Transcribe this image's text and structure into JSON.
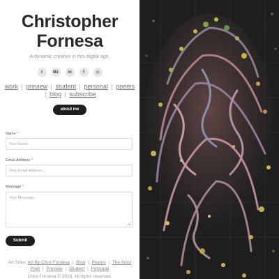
{
  "header": {
    "title_line1": "Christopher",
    "title_line2": "Fornesa",
    "tagline": "A dynamic creative in this digital age."
  },
  "socials": [
    {
      "icon": "twitter-icon",
      "glyph": "t"
    },
    {
      "icon": "behance-icon",
      "glyph": "Bē"
    },
    {
      "icon": "linkedin-icon",
      "glyph": "in"
    },
    {
      "icon": "facebook-icon",
      "glyph": "f"
    },
    {
      "icon": "instagram-icon",
      "glyph": "◎"
    }
  ],
  "nav": {
    "links": [
      "work",
      "preview",
      "student",
      "personal",
      "poems",
      "blog",
      "subscribe"
    ],
    "separator": "|"
  },
  "about_button": "about me",
  "form": {
    "name_label": "Name",
    "name_placeholder": "Your Name...",
    "email_label": "Email Address",
    "email_placeholder": "Your Email Address...",
    "message_label": "Message",
    "message_placeholder": "Your Message...",
    "required_mark": "*",
    "submit": "Submit"
  },
  "footer": {
    "art_sites_prefix": "Art Sites:",
    "art_sites": [
      "Art By Chris Fornesa",
      "Blog",
      "Poems",
      "The Artist Poet",
      "Preview",
      "Student",
      "Personal"
    ],
    "copyright": "Chris Fornesa © 2019. All rights reserved."
  },
  "colors": {
    "button_bg": "#1e1e1e",
    "required": "#d9534f",
    "art_bg": "#1c1c1c"
  }
}
